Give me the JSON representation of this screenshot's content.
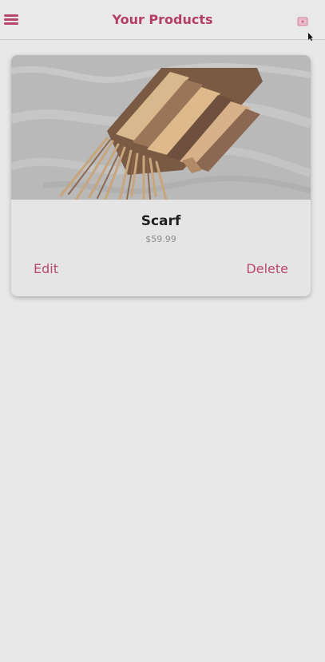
{
  "header": {
    "title": "Your Products",
    "menu_icon": "menu-icon",
    "add_icon": "add-product-icon",
    "accent_color": "#b33f69"
  },
  "products": [
    {
      "name": "Scarf",
      "price": "$59.99",
      "edit_label": "Edit",
      "delete_label": "Delete",
      "image_subject": "scarf-photo"
    }
  ]
}
